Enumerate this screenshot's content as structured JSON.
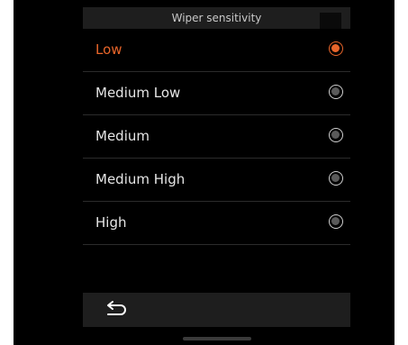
{
  "header": {
    "title": "Wiper sensitivity"
  },
  "options": [
    {
      "label": "Low",
      "selected": true
    },
    {
      "label": "Medium Low",
      "selected": false
    },
    {
      "label": "Medium",
      "selected": false
    },
    {
      "label": "Medium High",
      "selected": false
    },
    {
      "label": "High",
      "selected": false
    }
  ],
  "footer": {
    "back_icon": "back-arrow-icon"
  },
  "colors": {
    "accent": "#e8652a",
    "background": "#000000",
    "header_bg": "#1e1e1e"
  }
}
